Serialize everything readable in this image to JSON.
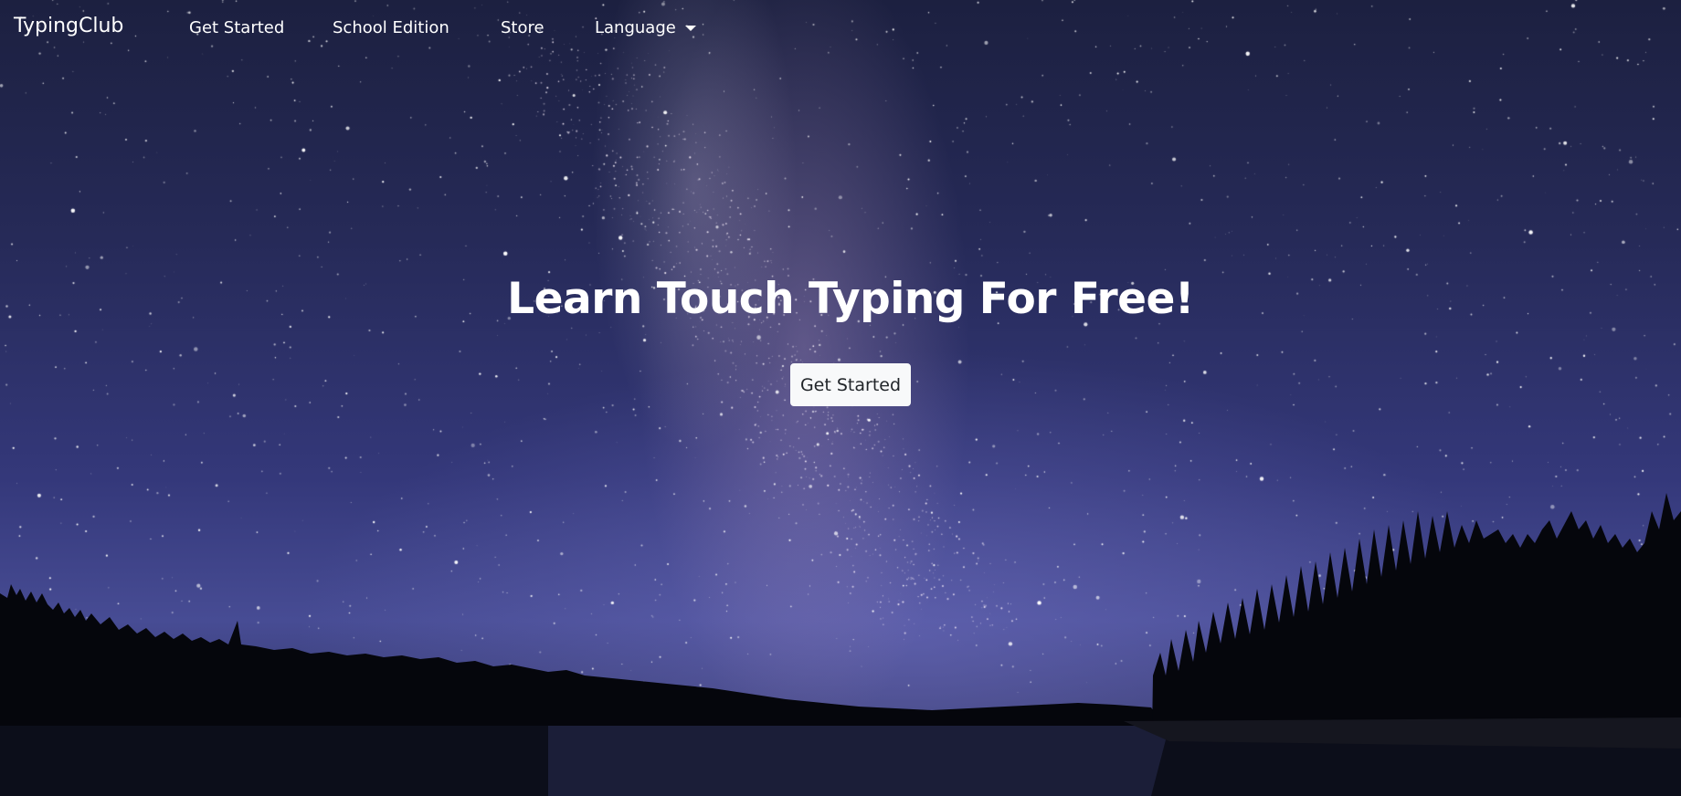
{
  "navbar": {
    "brand": "TypingClub",
    "links": [
      {
        "label": "Get Started"
      },
      {
        "label": "School Edition"
      },
      {
        "label": "Store"
      },
      {
        "label": "Language",
        "icon": "caret-down-icon"
      }
    ]
  },
  "hero": {
    "headline": "Learn Touch Typing For Free!",
    "cta_label": "Get Started"
  },
  "colors": {
    "sky_top": "#1c2040",
    "sky_mid": "#34387a",
    "horizon": "#474c94",
    "silhouette": "#05060c",
    "button_bg": "#f8f9fa",
    "button_text": "#212529",
    "nav_text": "#ffffff"
  }
}
